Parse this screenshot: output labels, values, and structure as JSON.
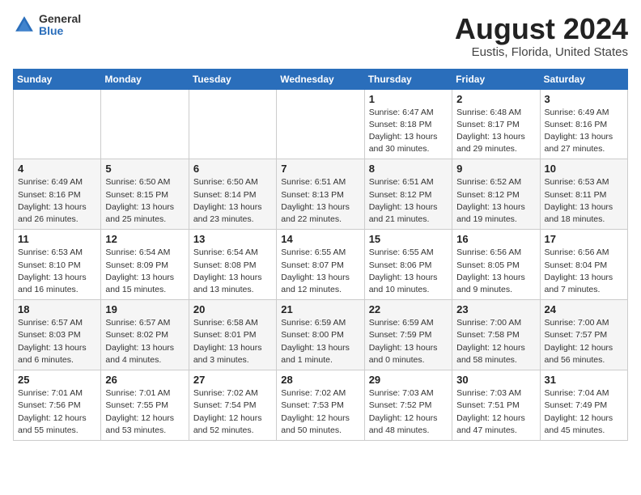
{
  "header": {
    "logo_general": "General",
    "logo_blue": "Blue",
    "title": "August 2024",
    "subtitle": "Eustis, Florida, United States"
  },
  "weekdays": [
    "Sunday",
    "Monday",
    "Tuesday",
    "Wednesday",
    "Thursday",
    "Friday",
    "Saturday"
  ],
  "weeks": [
    [
      {
        "day": "",
        "empty": true
      },
      {
        "day": "",
        "empty": true
      },
      {
        "day": "",
        "empty": true
      },
      {
        "day": "",
        "empty": true
      },
      {
        "day": "1",
        "sunrise": "Sunrise: 6:47 AM",
        "sunset": "Sunset: 8:18 PM",
        "daylight": "Daylight: 13 hours and 30 minutes."
      },
      {
        "day": "2",
        "sunrise": "Sunrise: 6:48 AM",
        "sunset": "Sunset: 8:17 PM",
        "daylight": "Daylight: 13 hours and 29 minutes."
      },
      {
        "day": "3",
        "sunrise": "Sunrise: 6:49 AM",
        "sunset": "Sunset: 8:16 PM",
        "daylight": "Daylight: 13 hours and 27 minutes."
      }
    ],
    [
      {
        "day": "4",
        "sunrise": "Sunrise: 6:49 AM",
        "sunset": "Sunset: 8:16 PM",
        "daylight": "Daylight: 13 hours and 26 minutes."
      },
      {
        "day": "5",
        "sunrise": "Sunrise: 6:50 AM",
        "sunset": "Sunset: 8:15 PM",
        "daylight": "Daylight: 13 hours and 25 minutes."
      },
      {
        "day": "6",
        "sunrise": "Sunrise: 6:50 AM",
        "sunset": "Sunset: 8:14 PM",
        "daylight": "Daylight: 13 hours and 23 minutes."
      },
      {
        "day": "7",
        "sunrise": "Sunrise: 6:51 AM",
        "sunset": "Sunset: 8:13 PM",
        "daylight": "Daylight: 13 hours and 22 minutes."
      },
      {
        "day": "8",
        "sunrise": "Sunrise: 6:51 AM",
        "sunset": "Sunset: 8:12 PM",
        "daylight": "Daylight: 13 hours and 21 minutes."
      },
      {
        "day": "9",
        "sunrise": "Sunrise: 6:52 AM",
        "sunset": "Sunset: 8:12 PM",
        "daylight": "Daylight: 13 hours and 19 minutes."
      },
      {
        "day": "10",
        "sunrise": "Sunrise: 6:53 AM",
        "sunset": "Sunset: 8:11 PM",
        "daylight": "Daylight: 13 hours and 18 minutes."
      }
    ],
    [
      {
        "day": "11",
        "sunrise": "Sunrise: 6:53 AM",
        "sunset": "Sunset: 8:10 PM",
        "daylight": "Daylight: 13 hours and 16 minutes."
      },
      {
        "day": "12",
        "sunrise": "Sunrise: 6:54 AM",
        "sunset": "Sunset: 8:09 PM",
        "daylight": "Daylight: 13 hours and 15 minutes."
      },
      {
        "day": "13",
        "sunrise": "Sunrise: 6:54 AM",
        "sunset": "Sunset: 8:08 PM",
        "daylight": "Daylight: 13 hours and 13 minutes."
      },
      {
        "day": "14",
        "sunrise": "Sunrise: 6:55 AM",
        "sunset": "Sunset: 8:07 PM",
        "daylight": "Daylight: 13 hours and 12 minutes."
      },
      {
        "day": "15",
        "sunrise": "Sunrise: 6:55 AM",
        "sunset": "Sunset: 8:06 PM",
        "daylight": "Daylight: 13 hours and 10 minutes."
      },
      {
        "day": "16",
        "sunrise": "Sunrise: 6:56 AM",
        "sunset": "Sunset: 8:05 PM",
        "daylight": "Daylight: 13 hours and 9 minutes."
      },
      {
        "day": "17",
        "sunrise": "Sunrise: 6:56 AM",
        "sunset": "Sunset: 8:04 PM",
        "daylight": "Daylight: 13 hours and 7 minutes."
      }
    ],
    [
      {
        "day": "18",
        "sunrise": "Sunrise: 6:57 AM",
        "sunset": "Sunset: 8:03 PM",
        "daylight": "Daylight: 13 hours and 6 minutes."
      },
      {
        "day": "19",
        "sunrise": "Sunrise: 6:57 AM",
        "sunset": "Sunset: 8:02 PM",
        "daylight": "Daylight: 13 hours and 4 minutes."
      },
      {
        "day": "20",
        "sunrise": "Sunrise: 6:58 AM",
        "sunset": "Sunset: 8:01 PM",
        "daylight": "Daylight: 13 hours and 3 minutes."
      },
      {
        "day": "21",
        "sunrise": "Sunrise: 6:59 AM",
        "sunset": "Sunset: 8:00 PM",
        "daylight": "Daylight: 13 hours and 1 minute."
      },
      {
        "day": "22",
        "sunrise": "Sunrise: 6:59 AM",
        "sunset": "Sunset: 7:59 PM",
        "daylight": "Daylight: 13 hours and 0 minutes."
      },
      {
        "day": "23",
        "sunrise": "Sunrise: 7:00 AM",
        "sunset": "Sunset: 7:58 PM",
        "daylight": "Daylight: 12 hours and 58 minutes."
      },
      {
        "day": "24",
        "sunrise": "Sunrise: 7:00 AM",
        "sunset": "Sunset: 7:57 PM",
        "daylight": "Daylight: 12 hours and 56 minutes."
      }
    ],
    [
      {
        "day": "25",
        "sunrise": "Sunrise: 7:01 AM",
        "sunset": "Sunset: 7:56 PM",
        "daylight": "Daylight: 12 hours and 55 minutes."
      },
      {
        "day": "26",
        "sunrise": "Sunrise: 7:01 AM",
        "sunset": "Sunset: 7:55 PM",
        "daylight": "Daylight: 12 hours and 53 minutes."
      },
      {
        "day": "27",
        "sunrise": "Sunrise: 7:02 AM",
        "sunset": "Sunset: 7:54 PM",
        "daylight": "Daylight: 12 hours and 52 minutes."
      },
      {
        "day": "28",
        "sunrise": "Sunrise: 7:02 AM",
        "sunset": "Sunset: 7:53 PM",
        "daylight": "Daylight: 12 hours and 50 minutes."
      },
      {
        "day": "29",
        "sunrise": "Sunrise: 7:03 AM",
        "sunset": "Sunset: 7:52 PM",
        "daylight": "Daylight: 12 hours and 48 minutes."
      },
      {
        "day": "30",
        "sunrise": "Sunrise: 7:03 AM",
        "sunset": "Sunset: 7:51 PM",
        "daylight": "Daylight: 12 hours and 47 minutes."
      },
      {
        "day": "31",
        "sunrise": "Sunrise: 7:04 AM",
        "sunset": "Sunset: 7:49 PM",
        "daylight": "Daylight: 12 hours and 45 minutes."
      }
    ]
  ]
}
